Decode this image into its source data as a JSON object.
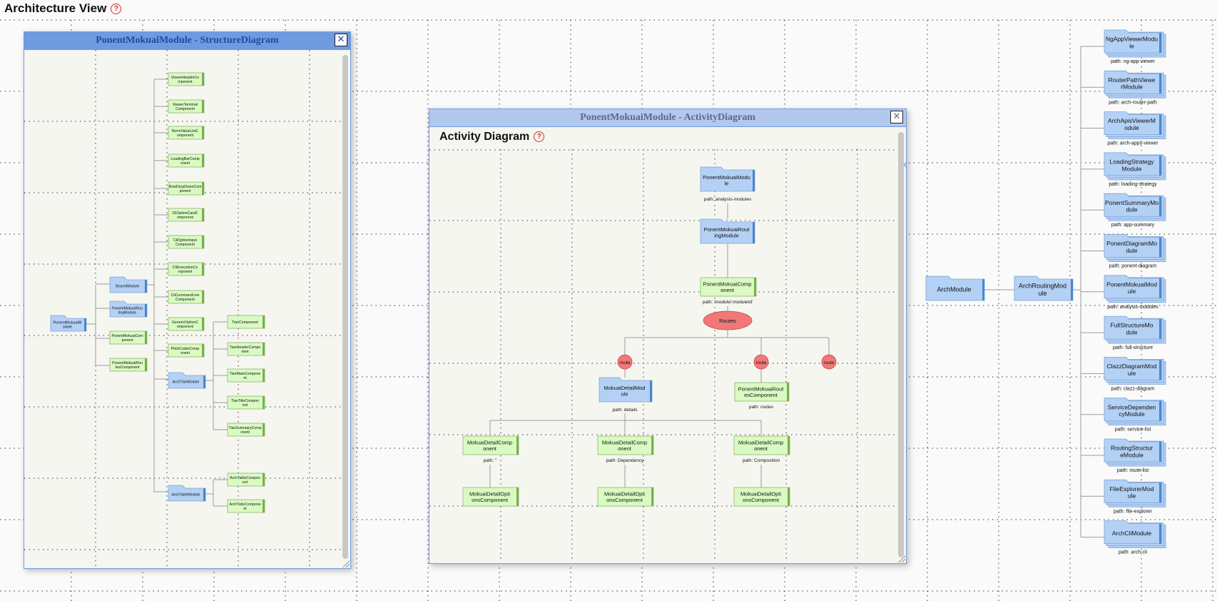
{
  "page": {
    "title": "Architecture View",
    "help_glyph": "?"
  },
  "colors": {
    "module": "#b3d1f5",
    "component": "#d9fbc2",
    "route": "#f07878",
    "window_header_focused": "#6f9ae0",
    "window_header_inactive": "#b3c8ee"
  },
  "arch": {
    "root": "ArchModule",
    "routing": "ArchRoutingModule",
    "children": [
      {
        "name": "NgAppViewerModule",
        "path": "path: ng-app-viewer"
      },
      {
        "name": "RouterPathViewerModule",
        "path": "path: arch-router-path"
      },
      {
        "name": "ArchApisViewerModule",
        "path": "path: arch-apps-viewer"
      },
      {
        "name": "LoadingStrategyModule",
        "path": "path: loading-strategy"
      },
      {
        "name": "PonentSummaryModule",
        "path": "path: app-summary"
      },
      {
        "name": "PonentDiagramModule",
        "path": "path: ponent-diagram"
      },
      {
        "name": "PonentMokuaiModule",
        "path": "path: analysis-modules"
      },
      {
        "name": "FullStructureModule",
        "path": "path: full-structure"
      },
      {
        "name": "ClazzDiagramModule",
        "path": "path: clazz-diagram"
      },
      {
        "name": "ServiceDependencyModule",
        "path": "path: service-list"
      },
      {
        "name": "RoutingStructureModule",
        "path": "path: route-list"
      },
      {
        "name": "FileExplorerModule",
        "path": "path: file-explorer"
      },
      {
        "name": "ArchCliModule",
        "path": "path: arch-cli"
      }
    ]
  },
  "structure": {
    "title": "PonentMokuaiModule - StructureDiagram",
    "close_glyph": "✕",
    "root": "PonentMokuaiModule",
    "level1": [
      {
        "name": "SharedModule",
        "kind": "module"
      },
      {
        "name": "PonentMokuaiRoutingModule",
        "kind": "module"
      },
      {
        "name": "PonentMokuaiComponent",
        "kind": "component"
      },
      {
        "name": "PonentMokuaiRoutesComponent",
        "kind": "component"
      }
    ],
    "shared_children": [
      {
        "name": "ViewerHeaderComponent",
        "kind": "component"
      },
      {
        "name": "ViewerTerminalComponent",
        "kind": "component"
      },
      {
        "name": "NormValueListComponent",
        "kind": "component"
      },
      {
        "name": "LoadingBarComponent",
        "kind": "component"
      },
      {
        "name": "RowDropDownComponent",
        "kind": "component"
      },
      {
        "name": "CliOptionCardComponent",
        "kind": "component"
      },
      {
        "name": "CliOptionInputComponent",
        "kind": "component"
      },
      {
        "name": "CliExecutionComponent",
        "kind": "component"
      },
      {
        "name": "CliCommandLineComponent",
        "kind": "component"
      },
      {
        "name": "GenericOptionComponent",
        "kind": "component"
      },
      {
        "name": "PitchCoderComponent",
        "kind": "component"
      },
      {
        "name": "ArchTianModule",
        "kind": "module"
      },
      {
        "name": "ArchTableModule",
        "kind": "module"
      }
    ],
    "tian_children": [
      "TianComponent",
      "TianHeaderComponent",
      "TianMainComponent",
      "TianTitleComponent",
      "TianSummaryComponent"
    ],
    "table_children": [
      "ArchTableComponent",
      "ArchTabsComponent"
    ]
  },
  "activity": {
    "window_title": "PonentMokuaiModule - ActivityDiagram",
    "close_glyph": "✕",
    "title": "Activity Diagram",
    "chevron": "‹",
    "module": {
      "name": "PonentMokuaiModule",
      "path": "path: analysis-modules"
    },
    "routing": "PonentMokuaiRoutingModule",
    "component": {
      "name": "PonentMokuaiComponent",
      "path": "path: 'module/:moduleId'"
    },
    "routes_label": "Routes",
    "route_label": "route",
    "detail_module": {
      "name": "MokuaiDetailModule",
      "path": "path: details"
    },
    "routes_component": {
      "name": "PonentMokuaiRoutesComponent",
      "path": "path: routes"
    },
    "details": [
      {
        "name": "MokuaiDetailComponent",
        "path": "path: ''",
        "options": "MokuaiDetailOptionsComponent"
      },
      {
        "name": "MokuaiDetailComponent",
        "path": "path: Dependency",
        "options": "MokuaiDetailOptionsComponent"
      },
      {
        "name": "MokuaiDetailComponent",
        "path": "path: Composition",
        "options": "MokuaiDetailOptionsComponent"
      }
    ]
  }
}
